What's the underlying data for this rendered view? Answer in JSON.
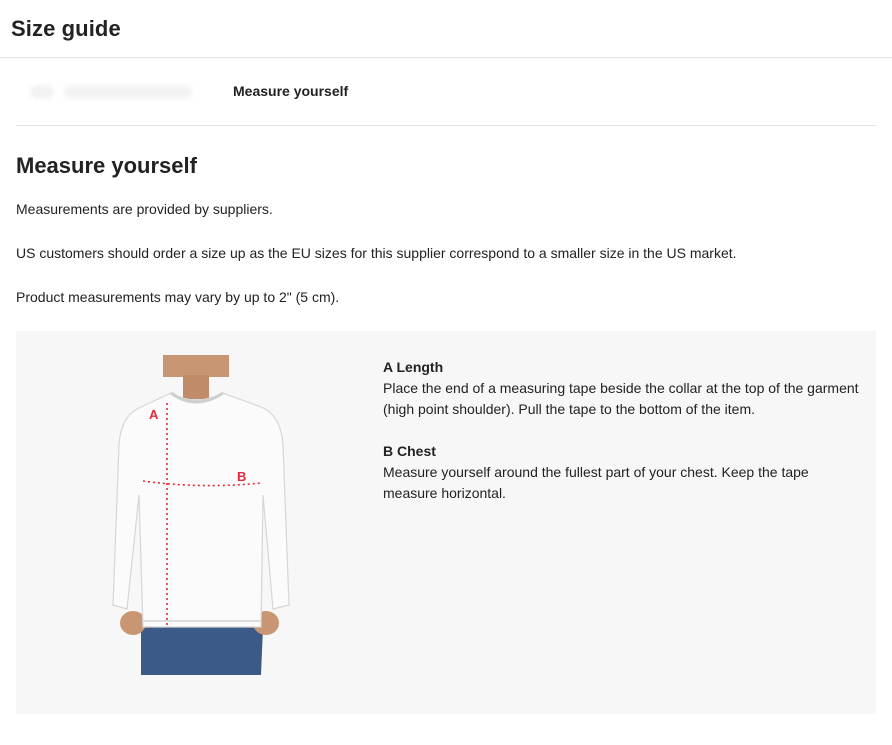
{
  "header": {
    "title": "Size guide"
  },
  "tabs": {
    "active_label": "Measure yourself"
  },
  "section": {
    "title": "Measure yourself",
    "notes": [
      "Measurements are provided by suppliers.",
      "US customers should order a size up as the EU sizes for this supplier correspond to a smaller size in the US market.",
      "Product measurements may vary by up to 2\" (5 cm)."
    ]
  },
  "figure": {
    "marker_a": "A",
    "marker_b": "B",
    "colors": {
      "sweatshirt": "#fbfbfb",
      "jeans": "#3b5a86",
      "skin": "#c99674",
      "tape": "#e02b3a"
    }
  },
  "measurements": [
    {
      "title": "A Length",
      "description": "Place the end of a measuring tape beside the collar at the top of the garment (high point shoulder). Pull the tape to the bottom of the item."
    },
    {
      "title": "B Chest",
      "description": "Measure yourself around the fullest part of your chest. Keep the tape measure horizontal."
    }
  ]
}
